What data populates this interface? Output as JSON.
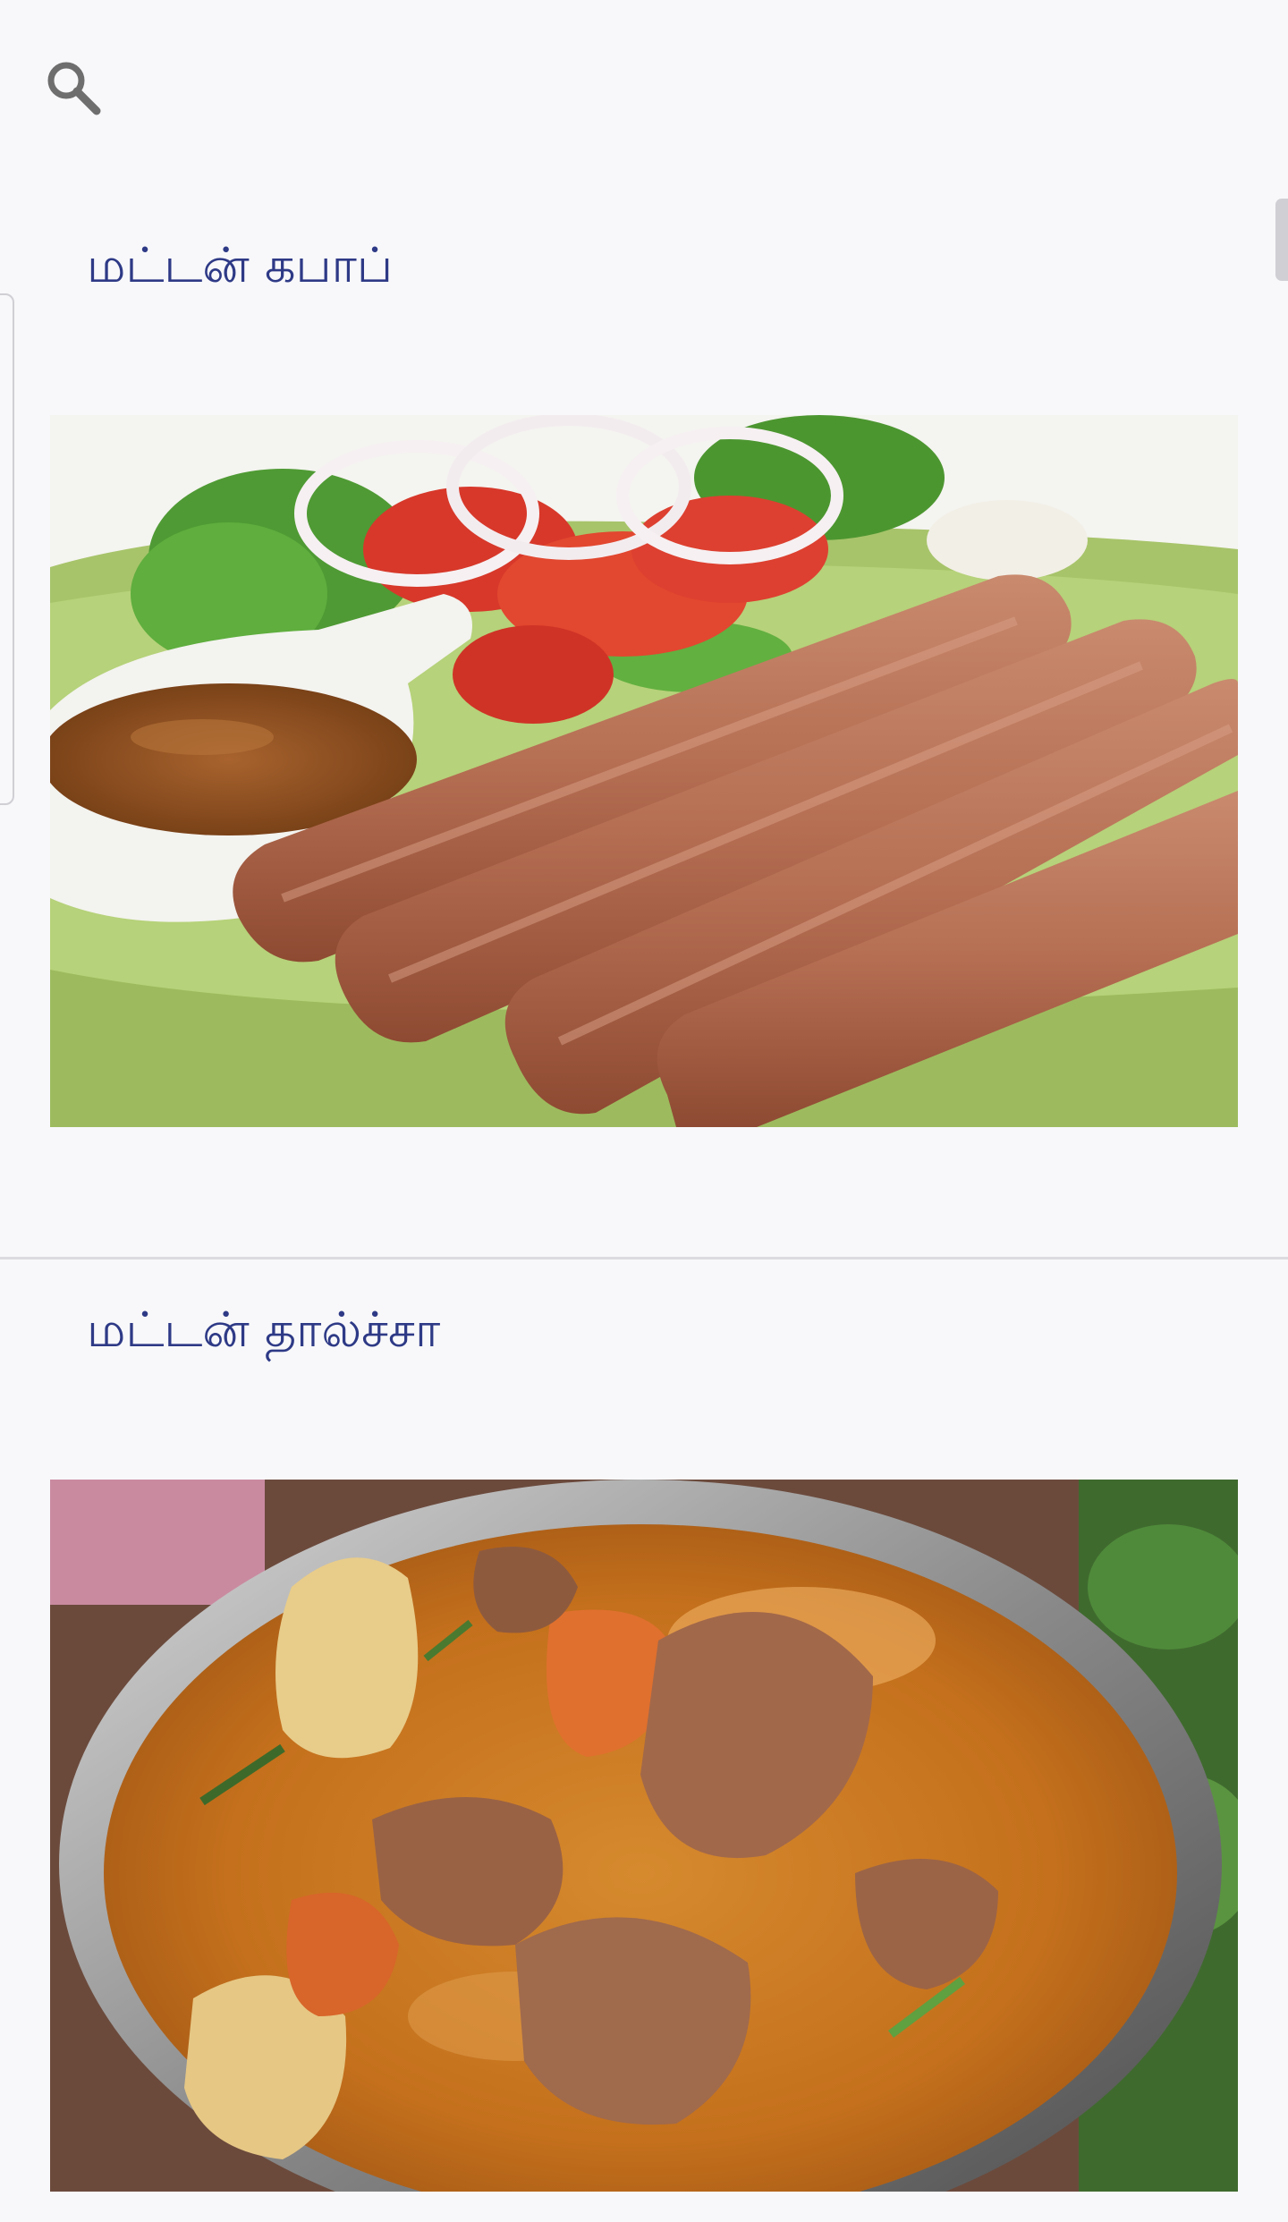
{
  "search": {
    "icon": "search-icon"
  },
  "recipes": [
    {
      "title": "மட்டன் கபாப்",
      "image": "mutton-kebab-photo"
    },
    {
      "title": "மட்டன் தால்ச்சா",
      "image": "mutton-dalcha-photo"
    }
  ],
  "colors": {
    "background": "#f8f8fa",
    "title": "#2e3a86",
    "divider": "#dcdce0"
  }
}
